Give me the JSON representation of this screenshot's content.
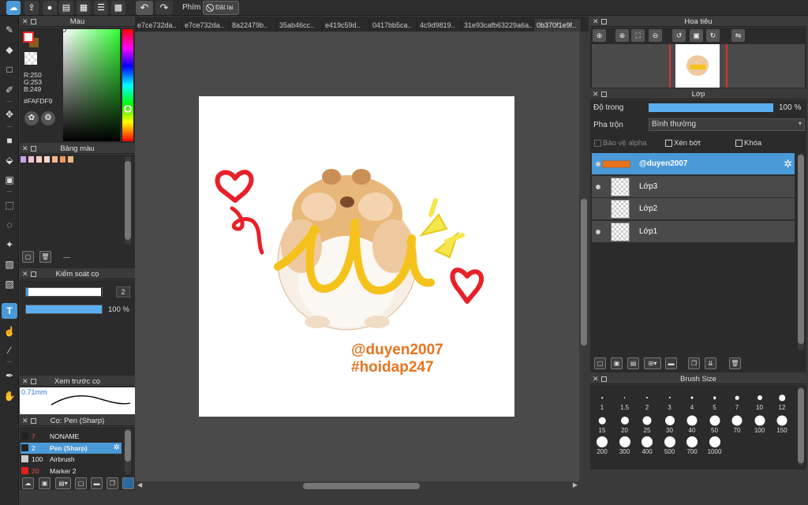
{
  "toolbar": {
    "keys_label": "Phím",
    "reset_label": "Đặt lại"
  },
  "tabs": [
    {
      "label": "e7ce732da.."
    },
    {
      "label": "e7ce732da.."
    },
    {
      "label": "8a22479b.."
    },
    {
      "label": "35ab46cc.."
    },
    {
      "label": "e419c59d.."
    },
    {
      "label": "0417bb5ca.."
    },
    {
      "label": "4c9d9819.."
    },
    {
      "label": "31e93cafb63229a6a.."
    },
    {
      "label": "0b370f1e9f.."
    }
  ],
  "color_panel": {
    "title": "Màu",
    "r": "R:250",
    "g": "G:253",
    "b": "B:249",
    "hex": "#FAFDF9",
    "current_color": "#FAFDF9"
  },
  "palette_panel": {
    "title": "Bảng màu",
    "swatches": [
      "#c8a2e8",
      "#f0c0d0",
      "#f8d0c0",
      "#f8d8c8",
      "#f0b890",
      "#e8985a",
      "#f0b880"
    ],
    "name_field": "---"
  },
  "brush_control": {
    "title": "Kiểm soát cọ",
    "size_value": "2",
    "opacity_value": "100 %",
    "opacity_fraction": 1.0
  },
  "brush_preview": {
    "title": "Xem trước cọ",
    "size_text": "0.71mm"
  },
  "brush_list": {
    "title": "Cọ: Pen (Sharp)",
    "items": [
      {
        "size": "7",
        "name": "NONAME",
        "color": "#222222",
        "selected": false
      },
      {
        "size": "2",
        "name": "Pen (Sharp)",
        "color": "#222222",
        "selected": true
      },
      {
        "size": "100",
        "name": "Airbrush",
        "color": "#cccccc",
        "selected": false
      },
      {
        "size": "20",
        "name": "Marker 2",
        "color": "#e02020",
        "selected": false
      }
    ]
  },
  "navigator": {
    "title": "Hoa tiêu"
  },
  "layer_panel": {
    "title": "Lớp",
    "opacity_label": "Độ trong",
    "opacity_value": "100 %",
    "opacity_fraction": 1.0,
    "blend_label": "Pha trộn",
    "blend_value": "Bình thường",
    "protect_alpha": "Bảo vệ alpha",
    "clipping": "Xén bớt",
    "lock": "Khóa",
    "layers": [
      {
        "name": "@duyen2007",
        "visible": true,
        "selected": true
      },
      {
        "name": "Lớp3",
        "visible": true,
        "selected": false
      },
      {
        "name": "Lớp2",
        "visible": false,
        "selected": false
      },
      {
        "name": "Lớp1",
        "visible": true,
        "selected": false
      }
    ]
  },
  "brush_size_panel": {
    "title": "Brush Size",
    "sizes": [
      "1",
      "1.5",
      "2",
      "3",
      "4",
      "5",
      "7",
      "10",
      "12",
      "15",
      "20",
      "25",
      "30",
      "40",
      "50",
      "70",
      "100",
      "150",
      "200",
      "300",
      "400",
      "500",
      "700",
      "1000"
    ]
  },
  "canvas": {
    "signature_line1": "@duyen2007",
    "signature_line2": "#hoidap247",
    "accent_red": "#e8202a",
    "accent_yellow": "#f5c21b",
    "accent_orange": "#e8731f"
  }
}
